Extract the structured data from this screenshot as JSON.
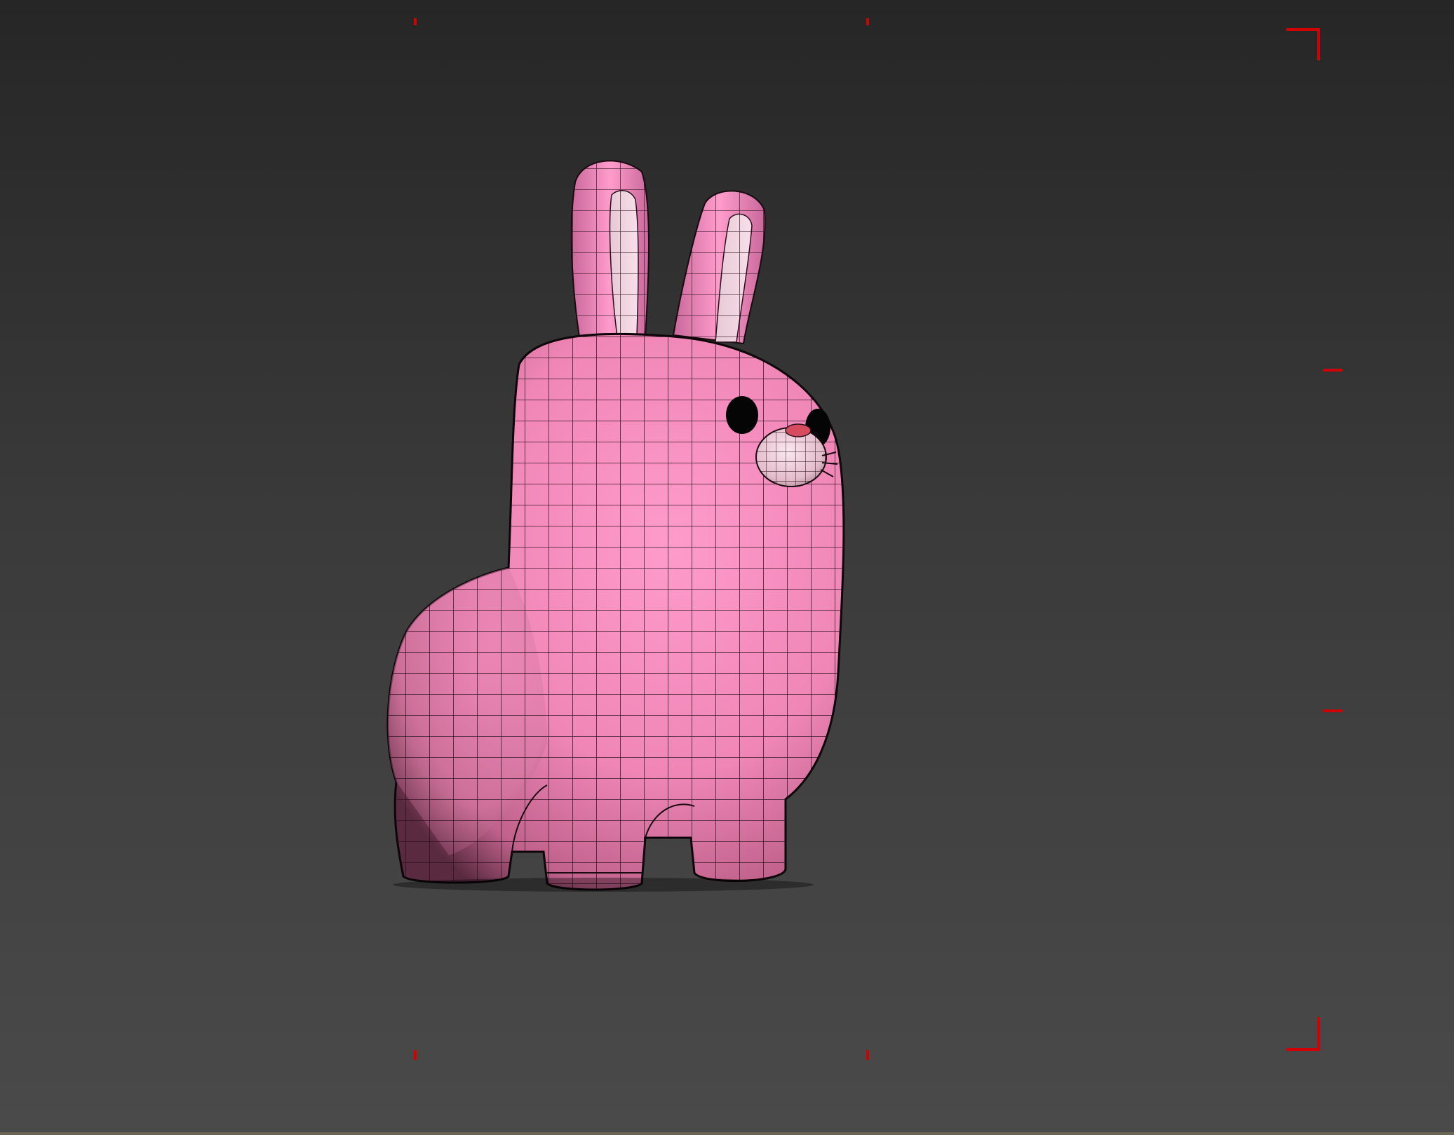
{
  "viewport": {
    "mode": "perspective",
    "shading": "edged-faces",
    "background_top": "#262626",
    "background_bottom": "#4a4a4a"
  },
  "model": {
    "subject": "bunny",
    "color": "#f08cba",
    "wireframe_color": "#1a0a10"
  },
  "safe_frame": {
    "color": "#d00000"
  }
}
